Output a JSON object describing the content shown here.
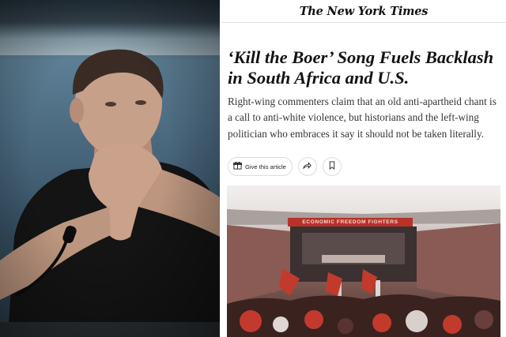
{
  "masthead": {
    "title": "The New York Times"
  },
  "article": {
    "headline": "‘Kill the Boer’ Song Fuels Backlash in South Africa and U.S.",
    "summary": "Right-wing commenters claim that an old anti-apartheid chant is a call to anti-white violence, but historians and the left-wing politician who embraces it say it should not be taken literally."
  },
  "share_bar": {
    "gift_label": "Give this article",
    "icons": [
      "gift-icon",
      "share-icon",
      "bookmark-icon"
    ]
  },
  "photo": {
    "banner_text": "ECONOMIC FREEDOM FIGHTERS"
  },
  "colors": {
    "text_primary": "#121212",
    "text_secondary": "#363636",
    "banner_red": "#b8322a"
  }
}
